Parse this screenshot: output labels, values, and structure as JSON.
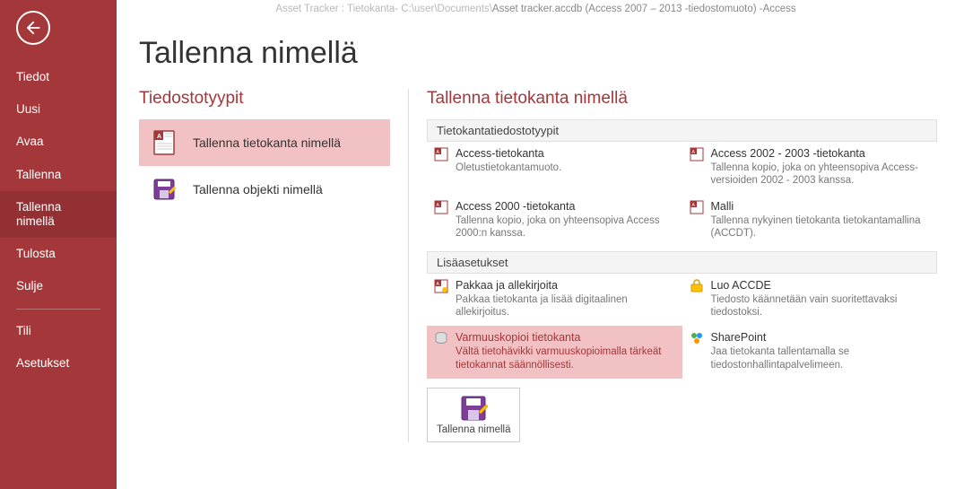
{
  "titlebar": {
    "prefix": "Asset Tracker : Tietokanta- C:\\user\\Documents\\",
    "main": "Asset tracker.accdb (Access 2007 – 2013 -tiedostomuoto) -Access"
  },
  "nav": {
    "tiedot": "Tiedot",
    "uusi": "Uusi",
    "avaa": "Avaa",
    "tallenna": "Tallenna",
    "tallenna_nimella": "Tallenna nimellä",
    "tulosta": "Tulosta",
    "sulje": "Sulje",
    "tili": "Tili",
    "asetukset": "Asetukset"
  },
  "page": {
    "title": "Tallenna nimellä"
  },
  "left": {
    "heading": "Tiedostotyypit",
    "items": [
      {
        "label": "Tallenna tietokanta nimellä"
      },
      {
        "label": "Tallenna objekti nimellä"
      }
    ]
  },
  "right": {
    "heading": "Tallenna tietokanta nimellä",
    "group1": "Tietokantatiedostotyypit",
    "group2": "Lisäasetukset",
    "options": {
      "access_db": {
        "title": "Access-tietokanta",
        "desc": "Oletustietokantamuoto."
      },
      "access_2002": {
        "title": "Access 2002 - 2003 -tietokanta",
        "desc": "Tallenna kopio, joka on yhteensopiva Access-versioiden 2002 - 2003 kanssa."
      },
      "access_2000": {
        "title": "Access 2000 -tietokanta",
        "desc": "Tallenna kopio, joka on yhteensopiva Access 2000:n kanssa."
      },
      "malli": {
        "title": "Malli",
        "desc": "Tallenna nykyinen tietokanta tietokantamallina (ACCDT)."
      },
      "pakkaa": {
        "title": "Pakkaa ja allekirjoita",
        "desc": "Pakkaa tietokanta ja lisää digitaalinen allekirjoitus."
      },
      "accde": {
        "title": "Luo ACCDE",
        "desc": "Tiedosto käännetään vain suoritettavaksi tiedostoksi."
      },
      "varmuus": {
        "title": "Varmuuskopioi tietokanta",
        "desc": "Vältä tietohävikki varmuuskopioimalla tärkeät tietokannat säännöllisesti."
      },
      "sharepoint": {
        "title": "SharePoint",
        "desc": "Jaa tietokanta tallentamalla se tiedostonhallintapalvelimeen."
      }
    },
    "save_button": "Tallenna nimellä"
  }
}
